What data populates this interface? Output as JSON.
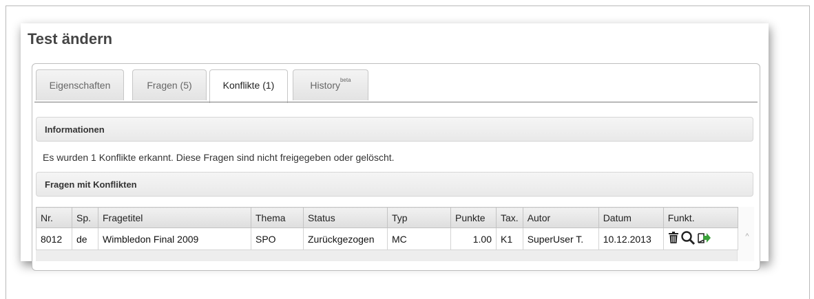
{
  "page": {
    "title": "Test ändern"
  },
  "tabs": [
    {
      "label": "Eigenschaften",
      "sup": ""
    },
    {
      "label": "Fragen (5)",
      "sup": ""
    },
    {
      "label": "Konflikte (1)",
      "sup": ""
    },
    {
      "label": "History",
      "sup": "beta"
    }
  ],
  "active_tab": "Konflikte (1)",
  "informationen": {
    "title": "Informationen",
    "text": "Es wurden 1 Konflikte erkannt. Diese Fragen sind nicht freigegeben oder gelöscht."
  },
  "konflikte": {
    "title": "Fragen mit Konflikten",
    "columns": [
      "Nr.",
      "Sp.",
      "Fragetitel",
      "Thema",
      "Status",
      "Typ",
      "Punkte",
      "Tax.",
      "Autor",
      "Datum",
      "Funkt."
    ],
    "rows": [
      {
        "nr": "8012",
        "sp": "de",
        "fragetitel": "Wimbledon Final 2009",
        "thema": "SPO",
        "status": "Zurückgezogen",
        "typ": "MC",
        "punkte": "1.00",
        "tax": "K1",
        "autor": "SuperUser T.",
        "datum": "10.12.2013",
        "funktionen": [
          "trash-icon",
          "search-icon",
          "export-icon"
        ]
      }
    ]
  },
  "colors": {
    "export_arrow": "#3aa23a",
    "tab_border": "#c6c6c6"
  }
}
